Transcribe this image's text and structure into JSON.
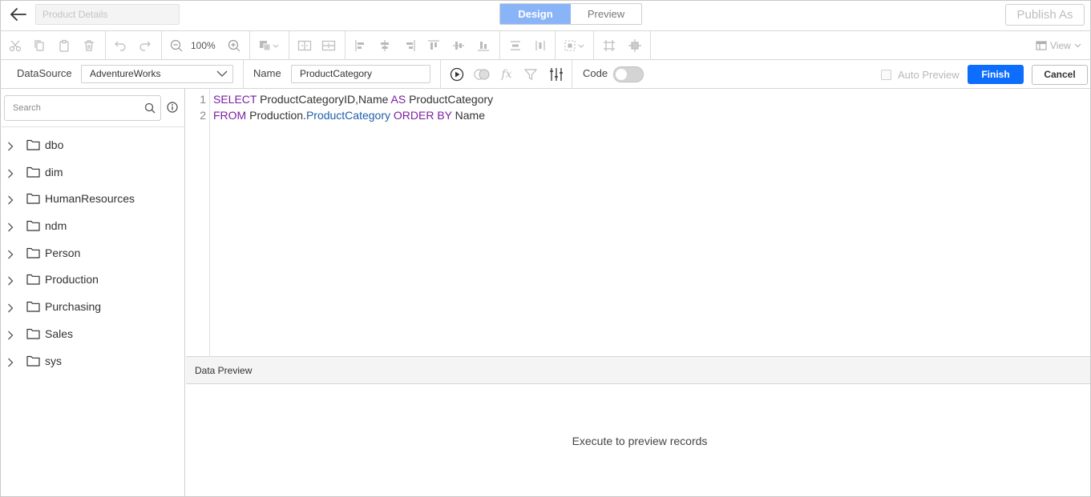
{
  "header": {
    "title_placeholder": "Product Details",
    "tabs": [
      "Design",
      "Preview"
    ],
    "publish_label": "Publish As"
  },
  "toolbar": {
    "zoom": "100%",
    "view_label": "View",
    "icons": [
      "cut-icon",
      "copy-icon",
      "paste-icon",
      "delete-icon",
      "undo-icon",
      "redo-icon",
      "zoom-out-icon",
      "zoom-in-icon",
      "shape-fill-icon",
      "group-icon",
      "ungroup-icon",
      "align-left-icon",
      "align-center-icon",
      "align-right-icon",
      "align-top-icon",
      "align-middle-icon",
      "align-bottom-icon",
      "distribute-horizontal-icon",
      "distribute-vertical-icon",
      "select-all-icon",
      "crop-icon",
      "resize-icon"
    ]
  },
  "querybar": {
    "datasource_label": "DataSource",
    "datasource_value": "AdventureWorks",
    "name_label": "Name",
    "name_value": "ProductCategory",
    "code_label": "Code",
    "auto_preview_label": "Auto Preview",
    "finish_label": "Finish",
    "cancel_label": "Cancel"
  },
  "left": {
    "search_placeholder": "Search",
    "tree": [
      "dbo",
      "dim",
      "HumanResources",
      "ndm",
      "Person",
      "Production",
      "Purchasing",
      "Sales",
      "sys"
    ]
  },
  "editor": {
    "line_numbers": [
      "1",
      "2"
    ],
    "line1": {
      "kw1": "SELECT",
      "t1": " ProductCategoryID,Name ",
      "kw2": "AS",
      "t2": " ProductCategory"
    },
    "line2": {
      "kw1": "FROM",
      "t1": " Production.",
      "obj": "ProductCategory",
      "t2": " ",
      "kw2": "ORDER BY",
      "t3": " Name"
    }
  },
  "preview": {
    "header": "Data Preview",
    "message": "Execute to preview records"
  },
  "colors": {
    "accent": "#0d6efd",
    "design_tab": "#8ab4f8",
    "keyword": "#7a1fa2",
    "object": "#1f5ea8"
  }
}
